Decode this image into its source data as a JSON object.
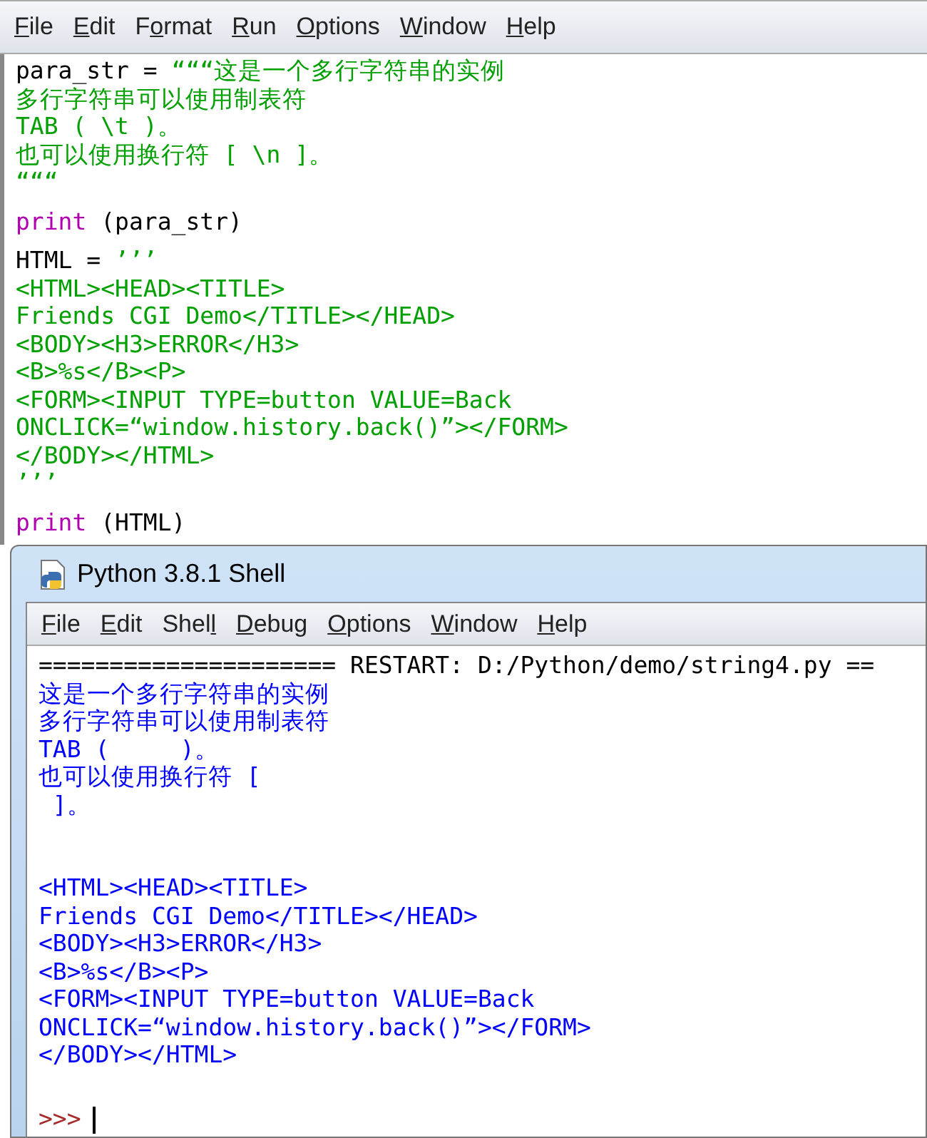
{
  "editor": {
    "menu": [
      {
        "key": "F",
        "rest": "ile"
      },
      {
        "key": "E",
        "rest": "dit"
      },
      {
        "pre": "F",
        "key": "o",
        "rest": "rmat"
      },
      {
        "key": "R",
        "rest": "un"
      },
      {
        "key": "O",
        "rest": "ptions"
      },
      {
        "key": "W",
        "rest": "indow"
      },
      {
        "key": "H",
        "rest": "elp"
      }
    ],
    "lines": [
      {
        "kind": "code",
        "segments": [
          {
            "kind": "plain",
            "text": "para_str = "
          },
          {
            "kind": "string",
            "text": "“““这是一个多行字符串的实例"
          }
        ]
      },
      {
        "kind": "code",
        "segments": [
          {
            "kind": "string",
            "text": "多行字符串可以使用制表符"
          }
        ]
      },
      {
        "kind": "code",
        "segments": [
          {
            "kind": "string",
            "text": "TAB ( \\t )。"
          }
        ]
      },
      {
        "kind": "code",
        "segments": [
          {
            "kind": "string",
            "text": "也可以使用换行符 [ \\n ]。"
          }
        ]
      },
      {
        "kind": "code",
        "segments": [
          {
            "kind": "string",
            "text": "“““"
          }
        ]
      },
      {
        "kind": "blank"
      },
      {
        "kind": "code",
        "segments": [
          {
            "kind": "keyword",
            "text": "print"
          },
          {
            "kind": "plain",
            "text": " (para_str)"
          }
        ]
      },
      {
        "kind": "blank"
      },
      {
        "kind": "code",
        "segments": [
          {
            "kind": "plain",
            "text": "HTML = "
          },
          {
            "kind": "string",
            "text": "’’’"
          }
        ]
      },
      {
        "kind": "code",
        "segments": [
          {
            "kind": "string",
            "text": "<HTML><HEAD><TITLE>"
          }
        ]
      },
      {
        "kind": "code",
        "segments": [
          {
            "kind": "string",
            "text": "Friends CGI Demo</TITLE></HEAD>"
          }
        ]
      },
      {
        "kind": "code",
        "segments": [
          {
            "kind": "string",
            "text": "<BODY><H3>ERROR</H3>"
          }
        ]
      },
      {
        "kind": "code",
        "segments": [
          {
            "kind": "string",
            "text": "<B>%s</B><P>"
          }
        ]
      },
      {
        "kind": "code",
        "segments": [
          {
            "kind": "string",
            "text": "<FORM><INPUT TYPE=button VALUE=Back"
          }
        ]
      },
      {
        "kind": "code",
        "segments": [
          {
            "kind": "string",
            "text": "ONCLICK=“window.history.back()”></FORM>"
          }
        ]
      },
      {
        "kind": "code",
        "segments": [
          {
            "kind": "string",
            "text": "</BODY></HTML>"
          }
        ]
      },
      {
        "kind": "code",
        "segments": [
          {
            "kind": "string",
            "text": "’’’"
          }
        ]
      },
      {
        "kind": "blank"
      },
      {
        "kind": "code",
        "segments": [
          {
            "kind": "keyword",
            "text": "print"
          },
          {
            "kind": "plain",
            "text": " (HTML)"
          }
        ]
      }
    ]
  },
  "shell": {
    "title": "Python 3.8.1 Shell",
    "menu": [
      {
        "key": "F",
        "rest": "ile"
      },
      {
        "key": "E",
        "rest": "dit"
      },
      {
        "pre": "Shel",
        "key": "l"
      },
      {
        "key": "D",
        "rest": "ebug"
      },
      {
        "key": "O",
        "rest": "ptions"
      },
      {
        "key": "W",
        "rest": "indow"
      },
      {
        "key": "H",
        "rest": "elp"
      }
    ],
    "lines": [
      {
        "kind": "plain",
        "text": "===================== RESTART: D:/Python/demo/string4.py =="
      },
      {
        "kind": "output",
        "text": "这是一个多行字符串的实例"
      },
      {
        "kind": "output",
        "text": "多行字符串可以使用制表符"
      },
      {
        "kind": "output",
        "text": "TAB (     )。"
      },
      {
        "kind": "output",
        "text": "也可以使用换行符 ["
      },
      {
        "kind": "output",
        "text": " ]。"
      },
      {
        "kind": "blank"
      },
      {
        "kind": "blank"
      },
      {
        "kind": "output",
        "text": "<HTML><HEAD><TITLE>"
      },
      {
        "kind": "output",
        "text": "Friends CGI Demo</TITLE></HEAD>"
      },
      {
        "kind": "output",
        "text": "<BODY><H3>ERROR</H3>"
      },
      {
        "kind": "output",
        "text": "<B>%s</B><P>"
      },
      {
        "kind": "output",
        "text": "<FORM><INPUT TYPE=button VALUE=Back"
      },
      {
        "kind": "output",
        "text": "ONCLICK=“window.history.back()”></FORM>"
      },
      {
        "kind": "output",
        "text": "</BODY></HTML>"
      },
      {
        "kind": "blank"
      }
    ],
    "prompt": ">>>"
  }
}
